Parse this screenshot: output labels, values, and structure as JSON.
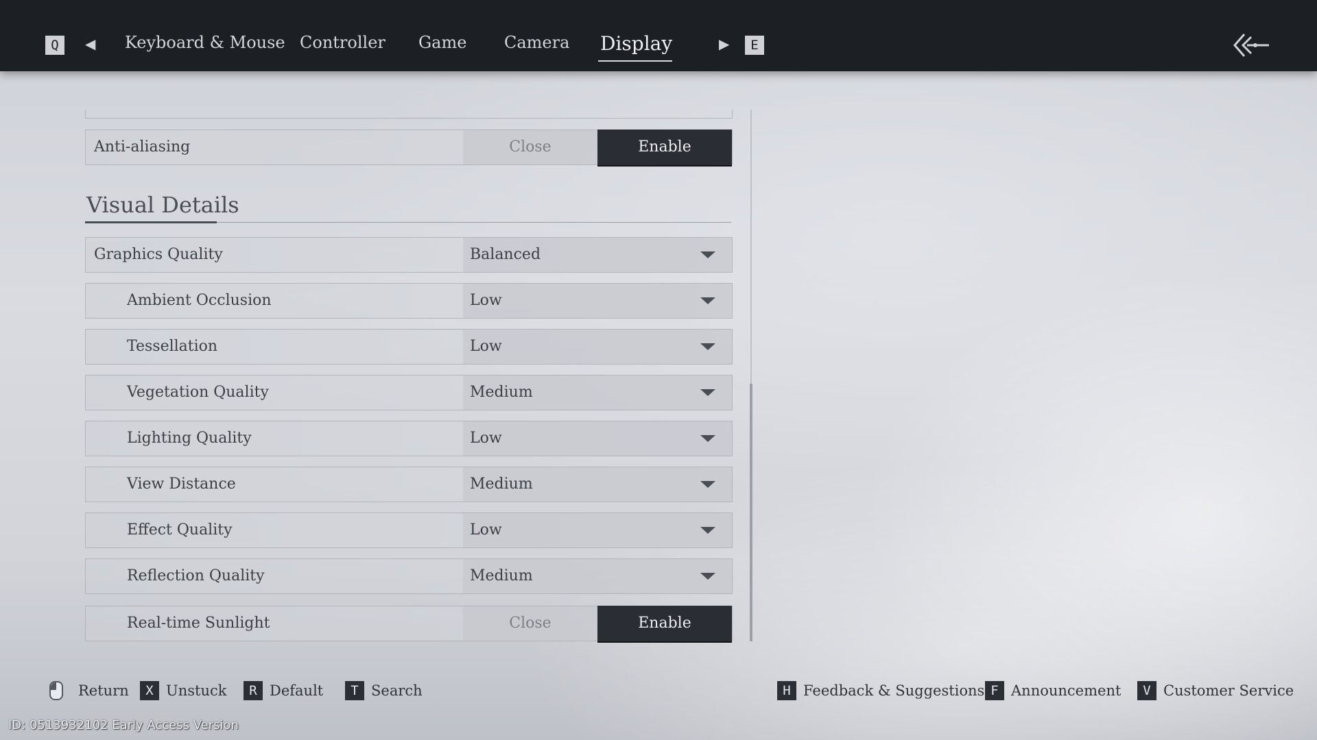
{
  "top_nav": {
    "prev_key": "Q",
    "next_key": "E",
    "tabs": [
      {
        "label": "Keyboard & Mouse"
      },
      {
        "label": "Controller"
      },
      {
        "label": "Game"
      },
      {
        "label": "Camera"
      },
      {
        "label": "Display"
      }
    ],
    "active_tab": "Display",
    "back_icon": "back-arrow-icon"
  },
  "settings": {
    "anti_aliasing": {
      "label": "Anti-aliasing",
      "off_label": "Close",
      "on_label": "Enable",
      "value": "Enable"
    },
    "section_title": "Visual Details",
    "dropdowns": [
      {
        "label": "Graphics Quality",
        "value": "Balanced"
      },
      {
        "label": "Ambient Occlusion",
        "value": "Low"
      },
      {
        "label": "Tessellation",
        "value": "Low"
      },
      {
        "label": "Vegetation Quality",
        "value": "Medium"
      },
      {
        "label": "Lighting Quality",
        "value": "Low"
      },
      {
        "label": "View Distance",
        "value": "Medium"
      },
      {
        "label": "Effect Quality",
        "value": "Low"
      },
      {
        "label": "Reflection Quality",
        "value": "Medium"
      }
    ],
    "realtime_sunlight": {
      "label": "Real-time Sunlight",
      "off_label": "Close",
      "on_label": "Enable",
      "value": "Enable"
    }
  },
  "footer": {
    "left": [
      {
        "key": "",
        "icon": "mouse-icon",
        "label": "Return"
      },
      {
        "key": "X",
        "label": "Unstuck"
      },
      {
        "key": "R",
        "label": "Default"
      },
      {
        "key": "T",
        "label": "Search"
      }
    ],
    "right": [
      {
        "key": "H",
        "label": "Feedback & Suggestions"
      },
      {
        "key": "F",
        "label": "Announcement"
      },
      {
        "key": "V",
        "label": "Customer Service"
      }
    ]
  },
  "build_id": "ID: 0513932102 Early Access Version"
}
